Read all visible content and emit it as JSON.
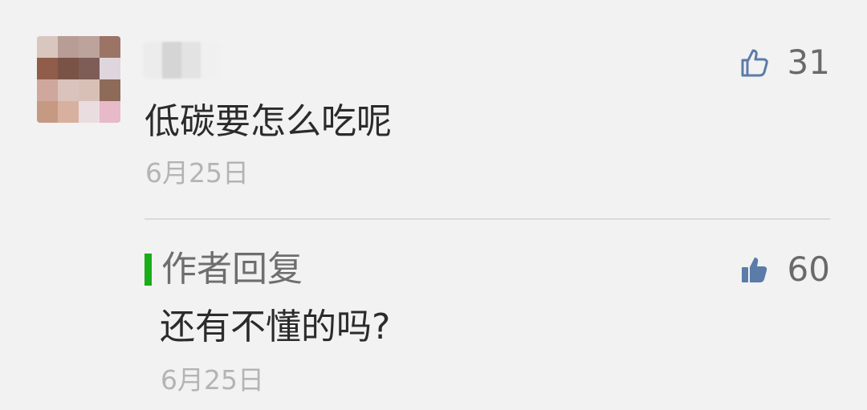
{
  "comment": {
    "text": "低碳要怎么吃呢",
    "date": "6月25日",
    "like_count": "31",
    "like_icon": "thumbs-up-outline-icon"
  },
  "author_reply": {
    "title": "作者回复",
    "text": "还有不懂的吗?",
    "date": "6月25日",
    "like_count": "60",
    "like_icon": "thumbs-up-filled-icon",
    "accent_color": "#1aad19"
  },
  "colors": {
    "background": "#f2f2f2",
    "primary_text": "#2b2b2b",
    "secondary_text": "#b4b4b4",
    "icon_blue": "#5b7ba9"
  }
}
